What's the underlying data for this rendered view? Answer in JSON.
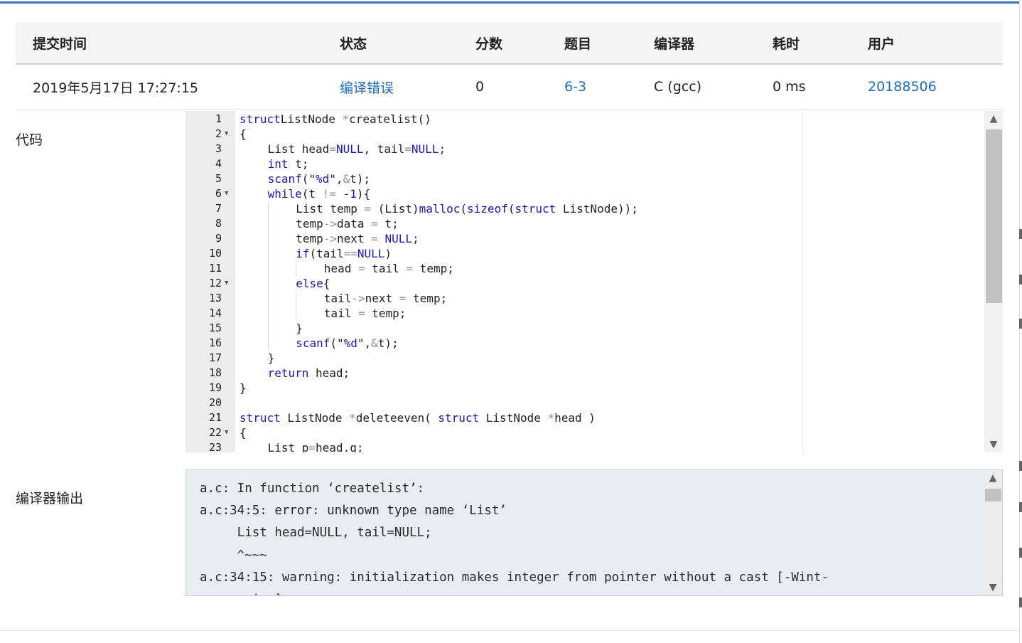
{
  "table": {
    "headers": [
      "提交时间",
      "状态",
      "分数",
      "题目",
      "编译器",
      "耗时",
      "用户"
    ],
    "row": {
      "time": "2019年5月17日 17:27:15",
      "status": "编译错误",
      "score": "0",
      "problem": "6-3",
      "compiler": "C (gcc)",
      "duration": "0 ms",
      "user": "20188506"
    }
  },
  "labels": {
    "code": "代码",
    "compiler_output": "编译器输出"
  },
  "code_lines": [
    {
      "n": "1",
      "fold": false,
      "indent": 0,
      "tokens": [
        [
          "kw",
          "struct"
        ],
        [
          "",
          "ListNode "
        ],
        [
          "op",
          "*"
        ],
        [
          "",
          "createlist()"
        ]
      ]
    },
    {
      "n": "2",
      "fold": true,
      "indent": 0,
      "tokens": [
        [
          "",
          "{"
        ]
      ]
    },
    {
      "n": "3",
      "fold": false,
      "indent": 1,
      "tokens": [
        [
          "",
          "List head"
        ],
        [
          "op",
          "="
        ],
        [
          "kw",
          "NULL"
        ],
        [
          "",
          ", tail"
        ],
        [
          "op",
          "="
        ],
        [
          "kw",
          "NULL"
        ],
        [
          "",
          ";"
        ]
      ]
    },
    {
      "n": "4",
      "fold": false,
      "indent": 1,
      "tokens": [
        [
          "kw",
          "int"
        ],
        [
          "",
          " t;"
        ]
      ]
    },
    {
      "n": "5",
      "fold": false,
      "indent": 1,
      "tokens": [
        [
          "kw",
          "scanf"
        ],
        [
          "",
          "(\""
        ],
        [
          "kw",
          "%d"
        ],
        [
          "",
          "\","
        ],
        [
          "op",
          "&"
        ],
        [
          "",
          "t);"
        ]
      ]
    },
    {
      "n": "6",
      "fold": true,
      "indent": 1,
      "tokens": [
        [
          "kw",
          "while"
        ],
        [
          "",
          "(t "
        ],
        [
          "op",
          "!="
        ],
        [
          "",
          " "
        ],
        [
          "num",
          "-1"
        ],
        [
          "",
          "){"
        ]
      ]
    },
    {
      "n": "7",
      "fold": false,
      "indent": 2,
      "tokens": [
        [
          "",
          "List temp "
        ],
        [
          "op",
          "="
        ],
        [
          "",
          " (List)"
        ],
        [
          "kw",
          "malloc"
        ],
        [
          "",
          "("
        ],
        [
          "kw",
          "sizeof"
        ],
        [
          "",
          "("
        ],
        [
          "kw",
          "struct"
        ],
        [
          "",
          " ListNode));"
        ]
      ]
    },
    {
      "n": "8",
      "fold": false,
      "indent": 2,
      "tokens": [
        [
          "",
          "temp"
        ],
        [
          "op",
          "->"
        ],
        [
          "",
          "data "
        ],
        [
          "op",
          "="
        ],
        [
          "",
          " t;"
        ]
      ]
    },
    {
      "n": "9",
      "fold": false,
      "indent": 2,
      "tokens": [
        [
          "",
          "temp"
        ],
        [
          "op",
          "->"
        ],
        [
          "",
          "next "
        ],
        [
          "op",
          "="
        ],
        [
          "",
          " "
        ],
        [
          "kw",
          "NULL"
        ],
        [
          "",
          ";"
        ]
      ]
    },
    {
      "n": "10",
      "fold": false,
      "indent": 2,
      "tokens": [
        [
          "kw",
          "if"
        ],
        [
          "",
          "(tail"
        ],
        [
          "op",
          "=="
        ],
        [
          "kw",
          "NULL"
        ],
        [
          "",
          ")"
        ]
      ]
    },
    {
      "n": "11",
      "fold": false,
      "indent": 3,
      "tokens": [
        [
          "",
          "head "
        ],
        [
          "op",
          "="
        ],
        [
          "",
          " tail "
        ],
        [
          "op",
          "="
        ],
        [
          "",
          " temp;"
        ]
      ]
    },
    {
      "n": "12",
      "fold": true,
      "indent": 2,
      "tokens": [
        [
          "kw",
          "else"
        ],
        [
          "",
          "{"
        ]
      ]
    },
    {
      "n": "13",
      "fold": false,
      "indent": 3,
      "tokens": [
        [
          "",
          "tail"
        ],
        [
          "op",
          "->"
        ],
        [
          "",
          "next "
        ],
        [
          "op",
          "="
        ],
        [
          "",
          " temp;"
        ]
      ]
    },
    {
      "n": "14",
      "fold": false,
      "indent": 3,
      "tokens": [
        [
          "",
          "tail "
        ],
        [
          "op",
          "="
        ],
        [
          "",
          " temp;"
        ]
      ]
    },
    {
      "n": "15",
      "fold": false,
      "indent": 2,
      "tokens": [
        [
          "",
          "}"
        ]
      ]
    },
    {
      "n": "16",
      "fold": false,
      "indent": 2,
      "tokens": [
        [
          "kw",
          "scanf"
        ],
        [
          "",
          "(\""
        ],
        [
          "kw",
          "%d"
        ],
        [
          "",
          "\","
        ],
        [
          "op",
          "&"
        ],
        [
          "",
          "t);"
        ]
      ]
    },
    {
      "n": "17",
      "fold": false,
      "indent": 1,
      "tokens": [
        [
          "",
          "}"
        ]
      ]
    },
    {
      "n": "18",
      "fold": false,
      "indent": 1,
      "tokens": [
        [
          "kw",
          "return"
        ],
        [
          "",
          " head;"
        ]
      ]
    },
    {
      "n": "19",
      "fold": false,
      "indent": 0,
      "tokens": [
        [
          "",
          "}"
        ]
      ]
    },
    {
      "n": "20",
      "fold": false,
      "indent": 0,
      "tokens": []
    },
    {
      "n": "21",
      "fold": false,
      "indent": 0,
      "tokens": [
        [
          "kw",
          "struct"
        ],
        [
          "",
          " ListNode "
        ],
        [
          "op",
          "*"
        ],
        [
          "",
          "deleteeven( "
        ],
        [
          "kw",
          "struct"
        ],
        [
          "",
          " ListNode "
        ],
        [
          "op",
          "*"
        ],
        [
          "",
          "head )"
        ]
      ]
    },
    {
      "n": "22",
      "fold": true,
      "indent": 0,
      "tokens": [
        [
          "",
          "{"
        ]
      ]
    },
    {
      "n": "23",
      "fold": false,
      "indent": 1,
      "tokens": [
        [
          "",
          "List p"
        ],
        [
          "op",
          "="
        ],
        [
          "",
          "head.q;"
        ]
      ]
    }
  ],
  "compiler_output_lines": [
    "a.c: In function ‘createlist’:",
    "a.c:34:5: error: unknown type name ‘List’",
    "     List head=NULL, tail=NULL;",
    "     ^~~~",
    "a.c:34:15: warning: initialization makes integer from pointer without a cast [-Wint-",
    "conversion]"
  ],
  "icons": {
    "scroll_up": "▲",
    "scroll_down": "▼",
    "fold": "▼"
  }
}
